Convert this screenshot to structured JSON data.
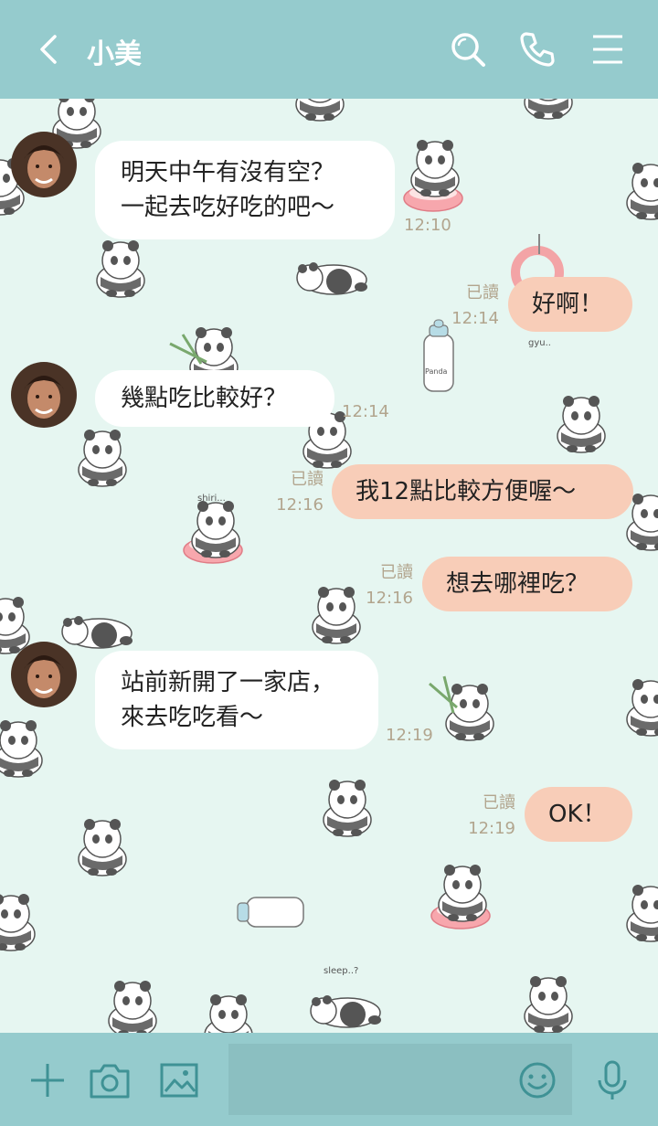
{
  "header": {
    "title": "小美",
    "back_icon": "chevron-left-icon",
    "search_icon": "search-icon",
    "call_icon": "phone-icon",
    "menu_icon": "menu-icon"
  },
  "messages": [
    {
      "dir": "in",
      "lines": [
        "明天中午有沒有空？",
        "一起去吃好吃的吧～"
      ],
      "time": "12:10"
    },
    {
      "dir": "out",
      "text": "好啊！",
      "read": "已讀",
      "time": "12:14"
    },
    {
      "dir": "in",
      "lines": [
        "幾點吃比較好？"
      ],
      "time": "12:14"
    },
    {
      "dir": "out",
      "text": "我12點比較方便喔～",
      "read": "已讀",
      "time": "12:16"
    },
    {
      "dir": "out",
      "text": "想去哪裡吃？",
      "read": "已讀",
      "time": "12:16"
    },
    {
      "dir": "in",
      "lines": [
        "站前新開了一家店，",
        "來去吃吃看～"
      ],
      "time": "12:19"
    },
    {
      "dir": "out",
      "text": "OK！",
      "read": "已讀",
      "time": "12:19"
    }
  ],
  "background_text": {
    "gyu": "gyu..",
    "shiri": "shiri...",
    "sleep": "sleep..?",
    "panda_label": "Panda"
  },
  "footer": {
    "add_icon": "plus-icon",
    "camera_icon": "camera-icon",
    "image_icon": "image-icon",
    "emoji_icon": "emoji-icon",
    "mic_icon": "microphone-icon",
    "input_value": ""
  },
  "colors": {
    "header": "#95cbcd",
    "chat_bg": "#e6f6f1",
    "incoming_bubble": "#ffffff",
    "outgoing_bubble": "#f8cdb8",
    "timestamp": "#b2a58e"
  }
}
